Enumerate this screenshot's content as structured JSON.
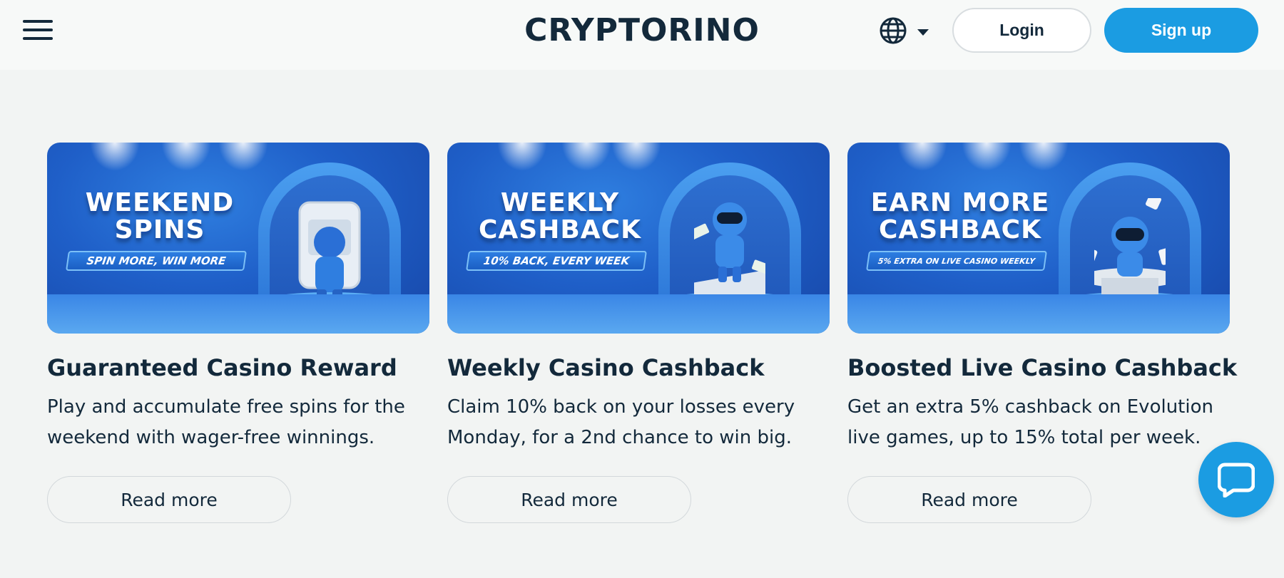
{
  "header": {
    "logo": "CRYPTORINO",
    "login_label": "Login",
    "signup_label": "Sign up",
    "menu_icon": "hamburger-menu-icon",
    "language_icon": "globe-icon"
  },
  "cards": [
    {
      "banner_title": "WEEKEND SPINS",
      "banner_subtitle": "SPIN MORE, WIN MORE",
      "title": "Guaranteed Casino Reward",
      "description": "Play and accumulate free spins for the weekend with wager-free winnings.",
      "button_label": "Read more"
    },
    {
      "banner_title": "WEEKLY CASHBACK",
      "banner_subtitle": "10% BACK, EVERY WEEK",
      "title": "Weekly Casino Cashback",
      "description": "Claim 10% back on your losses every Monday, for a 2nd chance to win big.",
      "button_label": "Read more"
    },
    {
      "banner_title": "EARN MORE CASHBACK",
      "banner_subtitle": "5% EXTRA ON LIVE CASINO WEEKLY",
      "title": "Boosted Live Casino Cashback",
      "description": "Get an extra 5% cashback on Evolution live games, up to 15% total per week.",
      "button_label": "Read more"
    }
  ],
  "chat": {
    "icon": "chat-bubble-icon"
  },
  "colors": {
    "brand_blue": "#1b9ce2",
    "text_dark": "#13293b",
    "page_bg": "#f2f4f3",
    "header_bg": "#f7f9f8"
  }
}
